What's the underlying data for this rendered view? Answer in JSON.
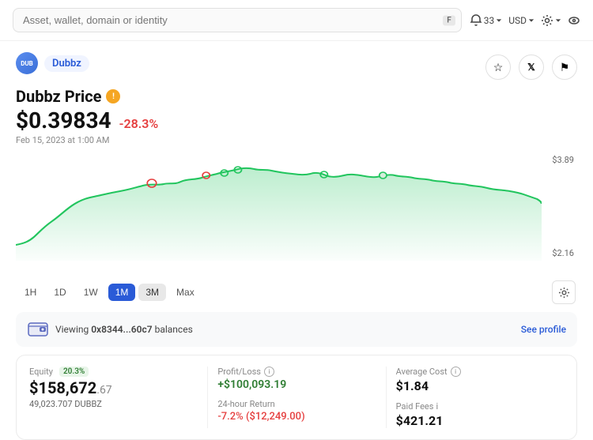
{
  "topbar": {
    "search_placeholder": "Asset, wallet, domain or identity",
    "search_shortcut": "F",
    "notifications_count": "33",
    "currency": "USD"
  },
  "token": {
    "logo_text": "DUB",
    "name": "Dubbz",
    "title": "Dubbz Price",
    "price": "$0.39834",
    "price_integer": "$0.",
    "price_decimal": "39834",
    "change": "-28.3%",
    "timestamp": "Feb 15, 2023 at 1:00 AM",
    "chart_high": "$3.89",
    "chart_low": "$2.16"
  },
  "time_controls": {
    "buttons": [
      "1H",
      "1D",
      "1W",
      "1M",
      "3M",
      "Max"
    ],
    "active": "1M",
    "hover": "3M"
  },
  "wallet": {
    "address": "0x8344...60c7",
    "label": "Viewing 0x8344...60c7 balances",
    "see_profile": "See profile"
  },
  "stats": {
    "equity_label": "Equity",
    "equity_pct": "20.3%",
    "equity_value_main": "$158,672",
    "equity_value_cents": ".67",
    "equity_tokens": "49,023.707 DUBBZ",
    "profit_loss_label": "Profit/Loss",
    "profit_loss_value": "+$100,093.19",
    "return_24h_label": "24-hour Return",
    "return_24h_value": "-7.2% ($12,249.00)",
    "avg_cost_label": "Average Cost",
    "avg_cost_value": "$1.84",
    "paid_fees_label": "Paid Fees",
    "paid_fees_value": "$421.21"
  },
  "icons": {
    "star": "☆",
    "twitter": "𝕏",
    "flag": "⚑",
    "settings": "⚙",
    "wallet_emoji": "🪙"
  }
}
